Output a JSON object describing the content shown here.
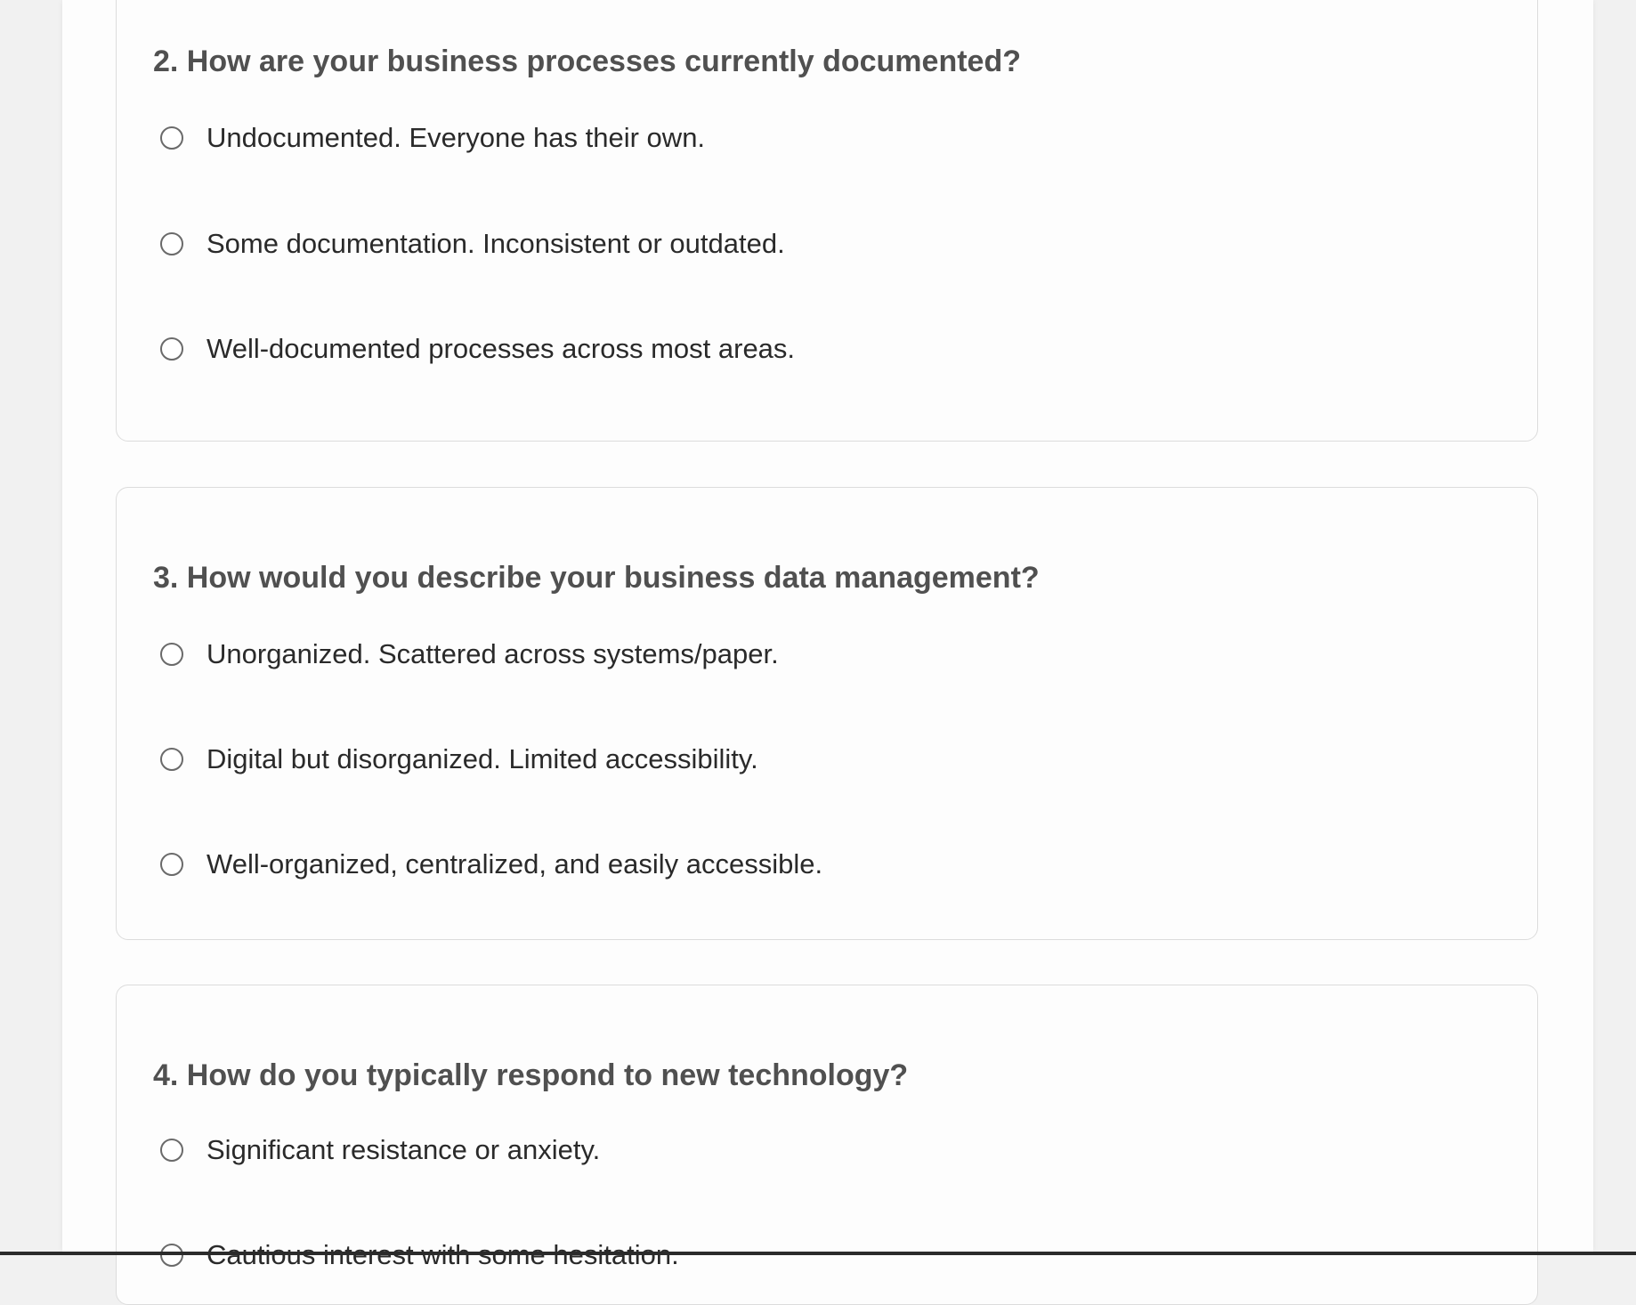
{
  "questions": [
    {
      "title": "2. How are your business processes currently documented?",
      "options": [
        "Undocumented. Everyone has their own.",
        "Some documentation. Inconsistent or outdated.",
        "Well-documented processes across most areas."
      ]
    },
    {
      "title": "3. How would you describe your business data management?",
      "options": [
        "Unorganized. Scattered across systems/paper.",
        "Digital but disorganized. Limited accessibility.",
        "Well-organized, centralized, and easily accessible."
      ]
    },
    {
      "title": "4. How do you typically respond to new technology?",
      "options": [
        "Significant resistance or anxiety.",
        "Cautious interest with some hesitation."
      ]
    }
  ],
  "colors": {
    "question_text": "#505050",
    "option_text": "#2a2a2a",
    "card_border": "#dcdcdc",
    "page_background": "#f1f1f1"
  }
}
